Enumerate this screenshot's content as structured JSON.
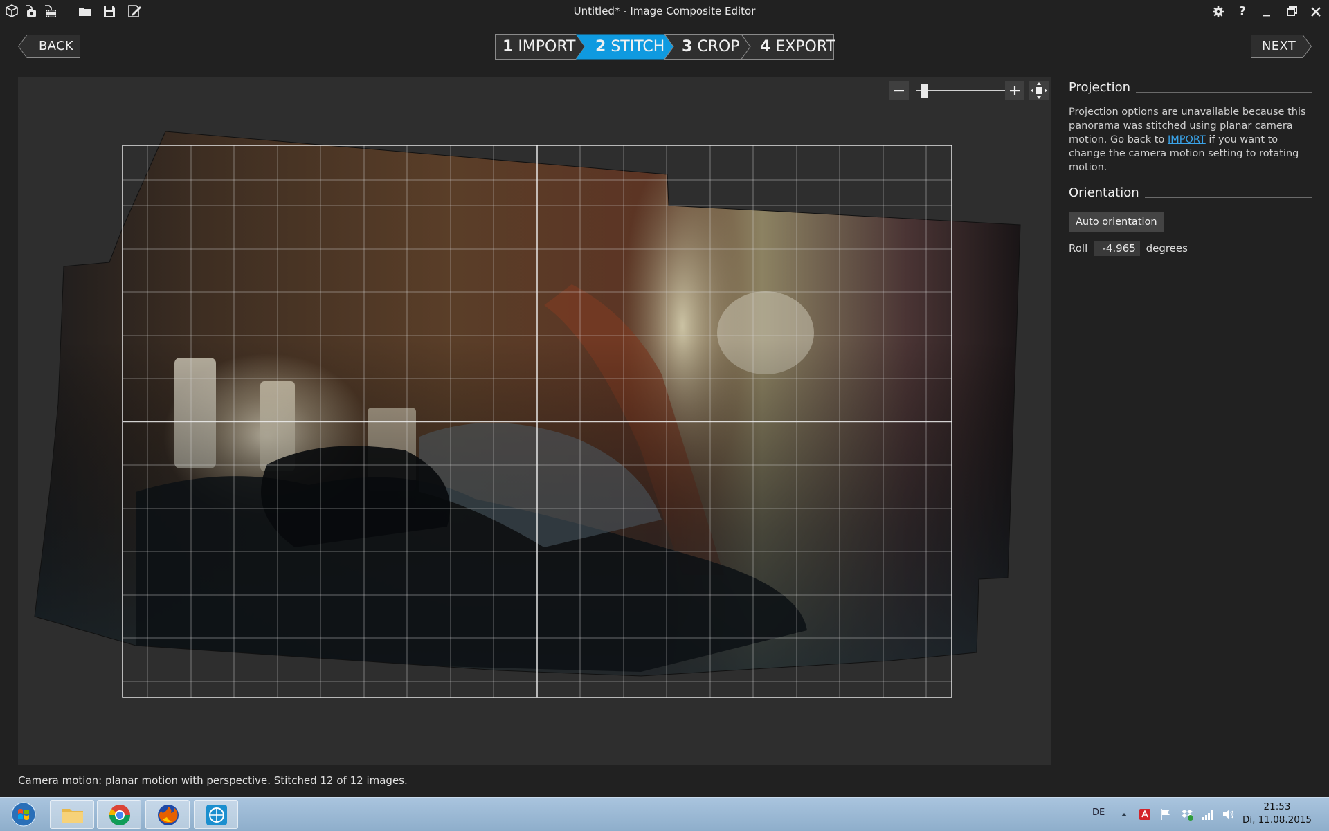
{
  "window": {
    "title": "Untitled* - Image Composite Editor",
    "toolbar_icons": [
      "new-project-icon",
      "new-panorama-from-images-icon",
      "new-panorama-from-video-icon",
      "open-project-icon",
      "save-icon",
      "save-as-icon"
    ],
    "window_icons": [
      "settings-icon",
      "help-icon",
      "minimize-icon",
      "restore-icon",
      "close-icon"
    ],
    "help_label": "?"
  },
  "nav": {
    "back_label": "BACK",
    "next_label": "NEXT",
    "steps": [
      {
        "num": "1",
        "label": "IMPORT",
        "active": false
      },
      {
        "num": "2",
        "label": "STITCH",
        "active": true
      },
      {
        "num": "3",
        "label": "CROP",
        "active": false
      },
      {
        "num": "4",
        "label": "EXPORT",
        "active": false
      }
    ]
  },
  "zoom": {
    "minus_label": "−",
    "plus_label": "+",
    "fit_icon": "fit-to-window-icon",
    "level": 0.05
  },
  "panel": {
    "projection": {
      "heading": "Projection",
      "text_before_link": "Projection options are unavailable because this panorama was stitched using planar camera motion. Go back to ",
      "link_text": "IMPORT",
      "text_after_link": " if you want to change the camera motion setting to rotating motion."
    },
    "orientation": {
      "heading": "Orientation",
      "auto_button": "Auto orientation",
      "roll_label": "Roll",
      "roll_value": "-4.965",
      "roll_unit": "degrees"
    }
  },
  "status": "Camera motion: planar motion with perspective. Stitched 12 of 12 images.",
  "taskbar": {
    "apps": [
      "windows-start-icon",
      "file-explorer-icon",
      "chrome-icon",
      "firefox-icon",
      "image-composite-editor-icon"
    ],
    "language": "DE",
    "tray_icons": [
      "show-hidden-icons-icon",
      "antivirus-icon",
      "action-center-flag-icon",
      "dropbox-icon",
      "network-icon",
      "volume-icon"
    ],
    "time": "21:53",
    "date": "Di, 11.08.2015"
  },
  "colors": {
    "background": "#212121",
    "canvas": "#2e2e2e",
    "accent": "#0f9ae0",
    "link": "#3aa3e8",
    "taskbar": "#a9c4de"
  }
}
